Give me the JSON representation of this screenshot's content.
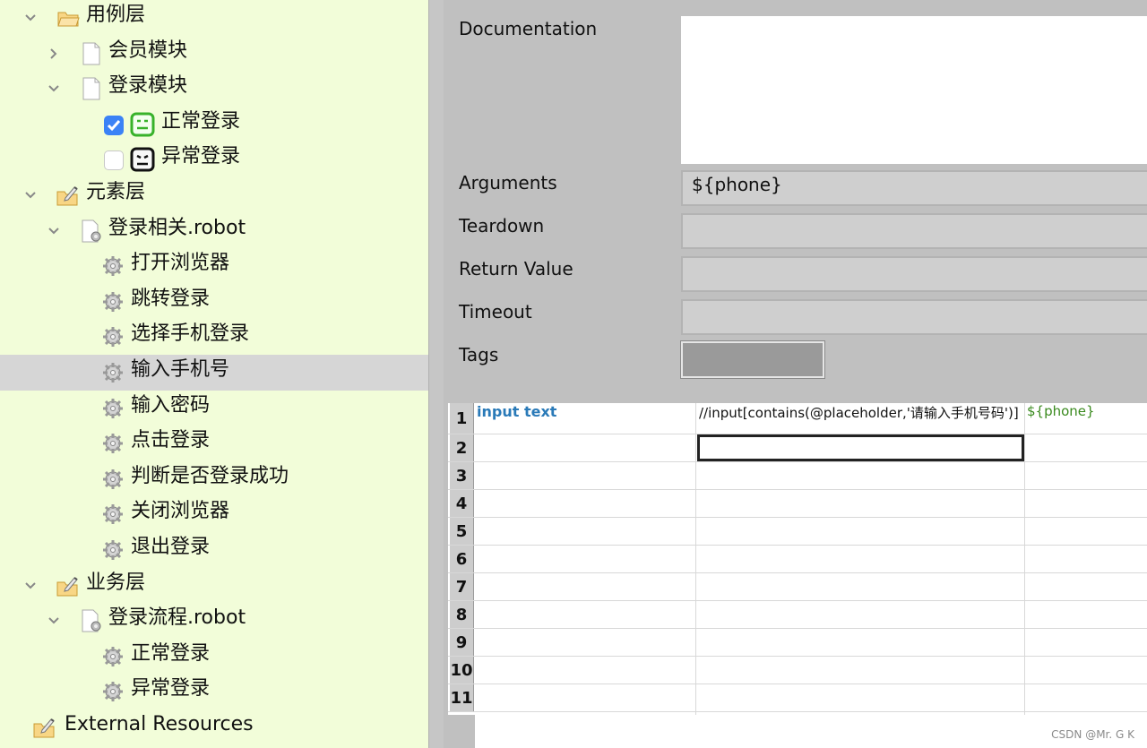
{
  "tree": {
    "nodes": [
      {
        "label": "用例层",
        "level": 0,
        "expanded": true,
        "icon": "folder-open-icon"
      },
      {
        "label": "会员模块",
        "level": 1,
        "expanded": false,
        "icon": "file-icon"
      },
      {
        "label": "登录模块",
        "level": 1,
        "expanded": true,
        "icon": "file-icon"
      },
      {
        "label": "正常登录",
        "level": 2,
        "checked": true,
        "icon": "robot-pass-icon"
      },
      {
        "label": "异常登录",
        "level": 2,
        "checked": false,
        "icon": "robot-fail-icon"
      },
      {
        "label": "元素层",
        "level": 0,
        "expanded": true,
        "icon": "folder-edit-icon"
      },
      {
        "label": "登录相关.robot",
        "level": 1,
        "expanded": true,
        "icon": "resource-file-icon"
      },
      {
        "label": "打开浏览器",
        "level": 2,
        "icon": "keyword-gear-icon"
      },
      {
        "label": "跳转登录",
        "level": 2,
        "icon": "keyword-gear-icon"
      },
      {
        "label": "选择手机登录",
        "level": 2,
        "icon": "keyword-gear-icon"
      },
      {
        "label": "输入手机号",
        "level": 2,
        "icon": "keyword-gear-icon",
        "selected": true
      },
      {
        "label": "输入密码",
        "level": 2,
        "icon": "keyword-gear-icon"
      },
      {
        "label": "点击登录",
        "level": 2,
        "icon": "keyword-gear-icon"
      },
      {
        "label": "判断是否登录成功",
        "level": 2,
        "icon": "keyword-gear-icon"
      },
      {
        "label": "关闭浏览器",
        "level": 2,
        "icon": "keyword-gear-icon"
      },
      {
        "label": "退出登录",
        "level": 2,
        "icon": "keyword-gear-icon"
      },
      {
        "label": "业务层",
        "level": 0,
        "expanded": true,
        "icon": "folder-edit-icon"
      },
      {
        "label": "登录流程.robot",
        "level": 1,
        "expanded": true,
        "icon": "resource-file-icon"
      },
      {
        "label": "正常登录",
        "level": 2,
        "icon": "keyword-gear-icon"
      },
      {
        "label": "异常登录",
        "level": 2,
        "icon": "keyword-gear-icon"
      },
      {
        "label": "External Resources",
        "level": -1,
        "icon": "folder-edit-icon"
      }
    ]
  },
  "settings": {
    "documentation_label": "Documentation",
    "documentation_value": "",
    "arguments_label": "Arguments",
    "arguments_value": "${phone}",
    "teardown_label": "Teardown",
    "return_value_label": "Return Value",
    "timeout_label": "Timeout",
    "tags_label": "Tags"
  },
  "grid": {
    "rows": [
      {
        "num": "1",
        "c1": "input text",
        "c2": "//input[contains(@placeholder,'请输入手机号码')]",
        "c3": "${phone}"
      },
      {
        "num": "2",
        "c1": "",
        "c2": "",
        "c3": ""
      },
      {
        "num": "3",
        "c1": "",
        "c2": "",
        "c3": ""
      },
      {
        "num": "4",
        "c1": "",
        "c2": "",
        "c3": ""
      },
      {
        "num": "5",
        "c1": "",
        "c2": "",
        "c3": ""
      },
      {
        "num": "6",
        "c1": "",
        "c2": "",
        "c3": ""
      },
      {
        "num": "7",
        "c1": "",
        "c2": "",
        "c3": ""
      },
      {
        "num": "8",
        "c1": "",
        "c2": "",
        "c3": ""
      },
      {
        "num": "9",
        "c1": "",
        "c2": "",
        "c3": ""
      },
      {
        "num": "10",
        "c1": "",
        "c2": "",
        "c3": ""
      },
      {
        "num": "11",
        "c1": "",
        "c2": "",
        "c3": ""
      }
    ]
  },
  "colors": {
    "tree_bg": "#f2fdd9",
    "keyword_blue": "#2a7ab8",
    "variable_green": "#3a8a1e",
    "checkbox_blue": "#3b82f6"
  },
  "watermark": "CSDN @Mr. G K"
}
